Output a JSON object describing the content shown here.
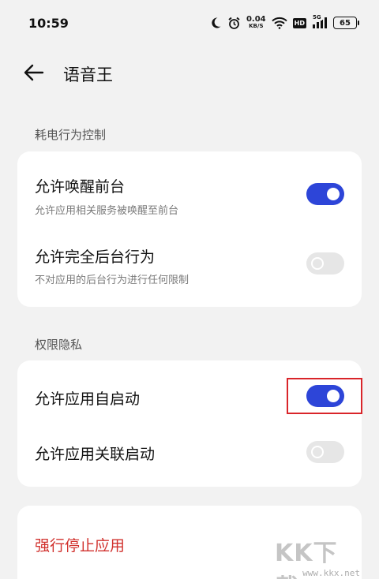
{
  "status_bar": {
    "time": "10:59",
    "net_speed_value": "0.04",
    "net_speed_unit": "KB/S",
    "hd_badge": "HD",
    "signal_label": "5G",
    "battery": "65"
  },
  "header": {
    "title": "语音王"
  },
  "sections": {
    "power": {
      "title": "耗电行为控制",
      "items": [
        {
          "title": "允许唤醒前台",
          "subtitle": "允许应用相关服务被唤醒至前台",
          "enabled": true
        },
        {
          "title": "允许完全后台行为",
          "subtitle": "不对应用的后台行为进行任何限制",
          "enabled": false
        }
      ]
    },
    "privacy": {
      "title": "权限隐私",
      "items": [
        {
          "title": "允许应用自启动",
          "enabled": true
        },
        {
          "title": "允许应用关联启动",
          "enabled": false
        }
      ]
    }
  },
  "actions": {
    "force_stop": "强行停止应用"
  },
  "colors": {
    "accent": "#2d45d8",
    "danger": "#d1312d",
    "highlight": "#d9252a"
  },
  "watermark": {
    "logo": "KK下载",
    "url": "www.kkx.net"
  }
}
